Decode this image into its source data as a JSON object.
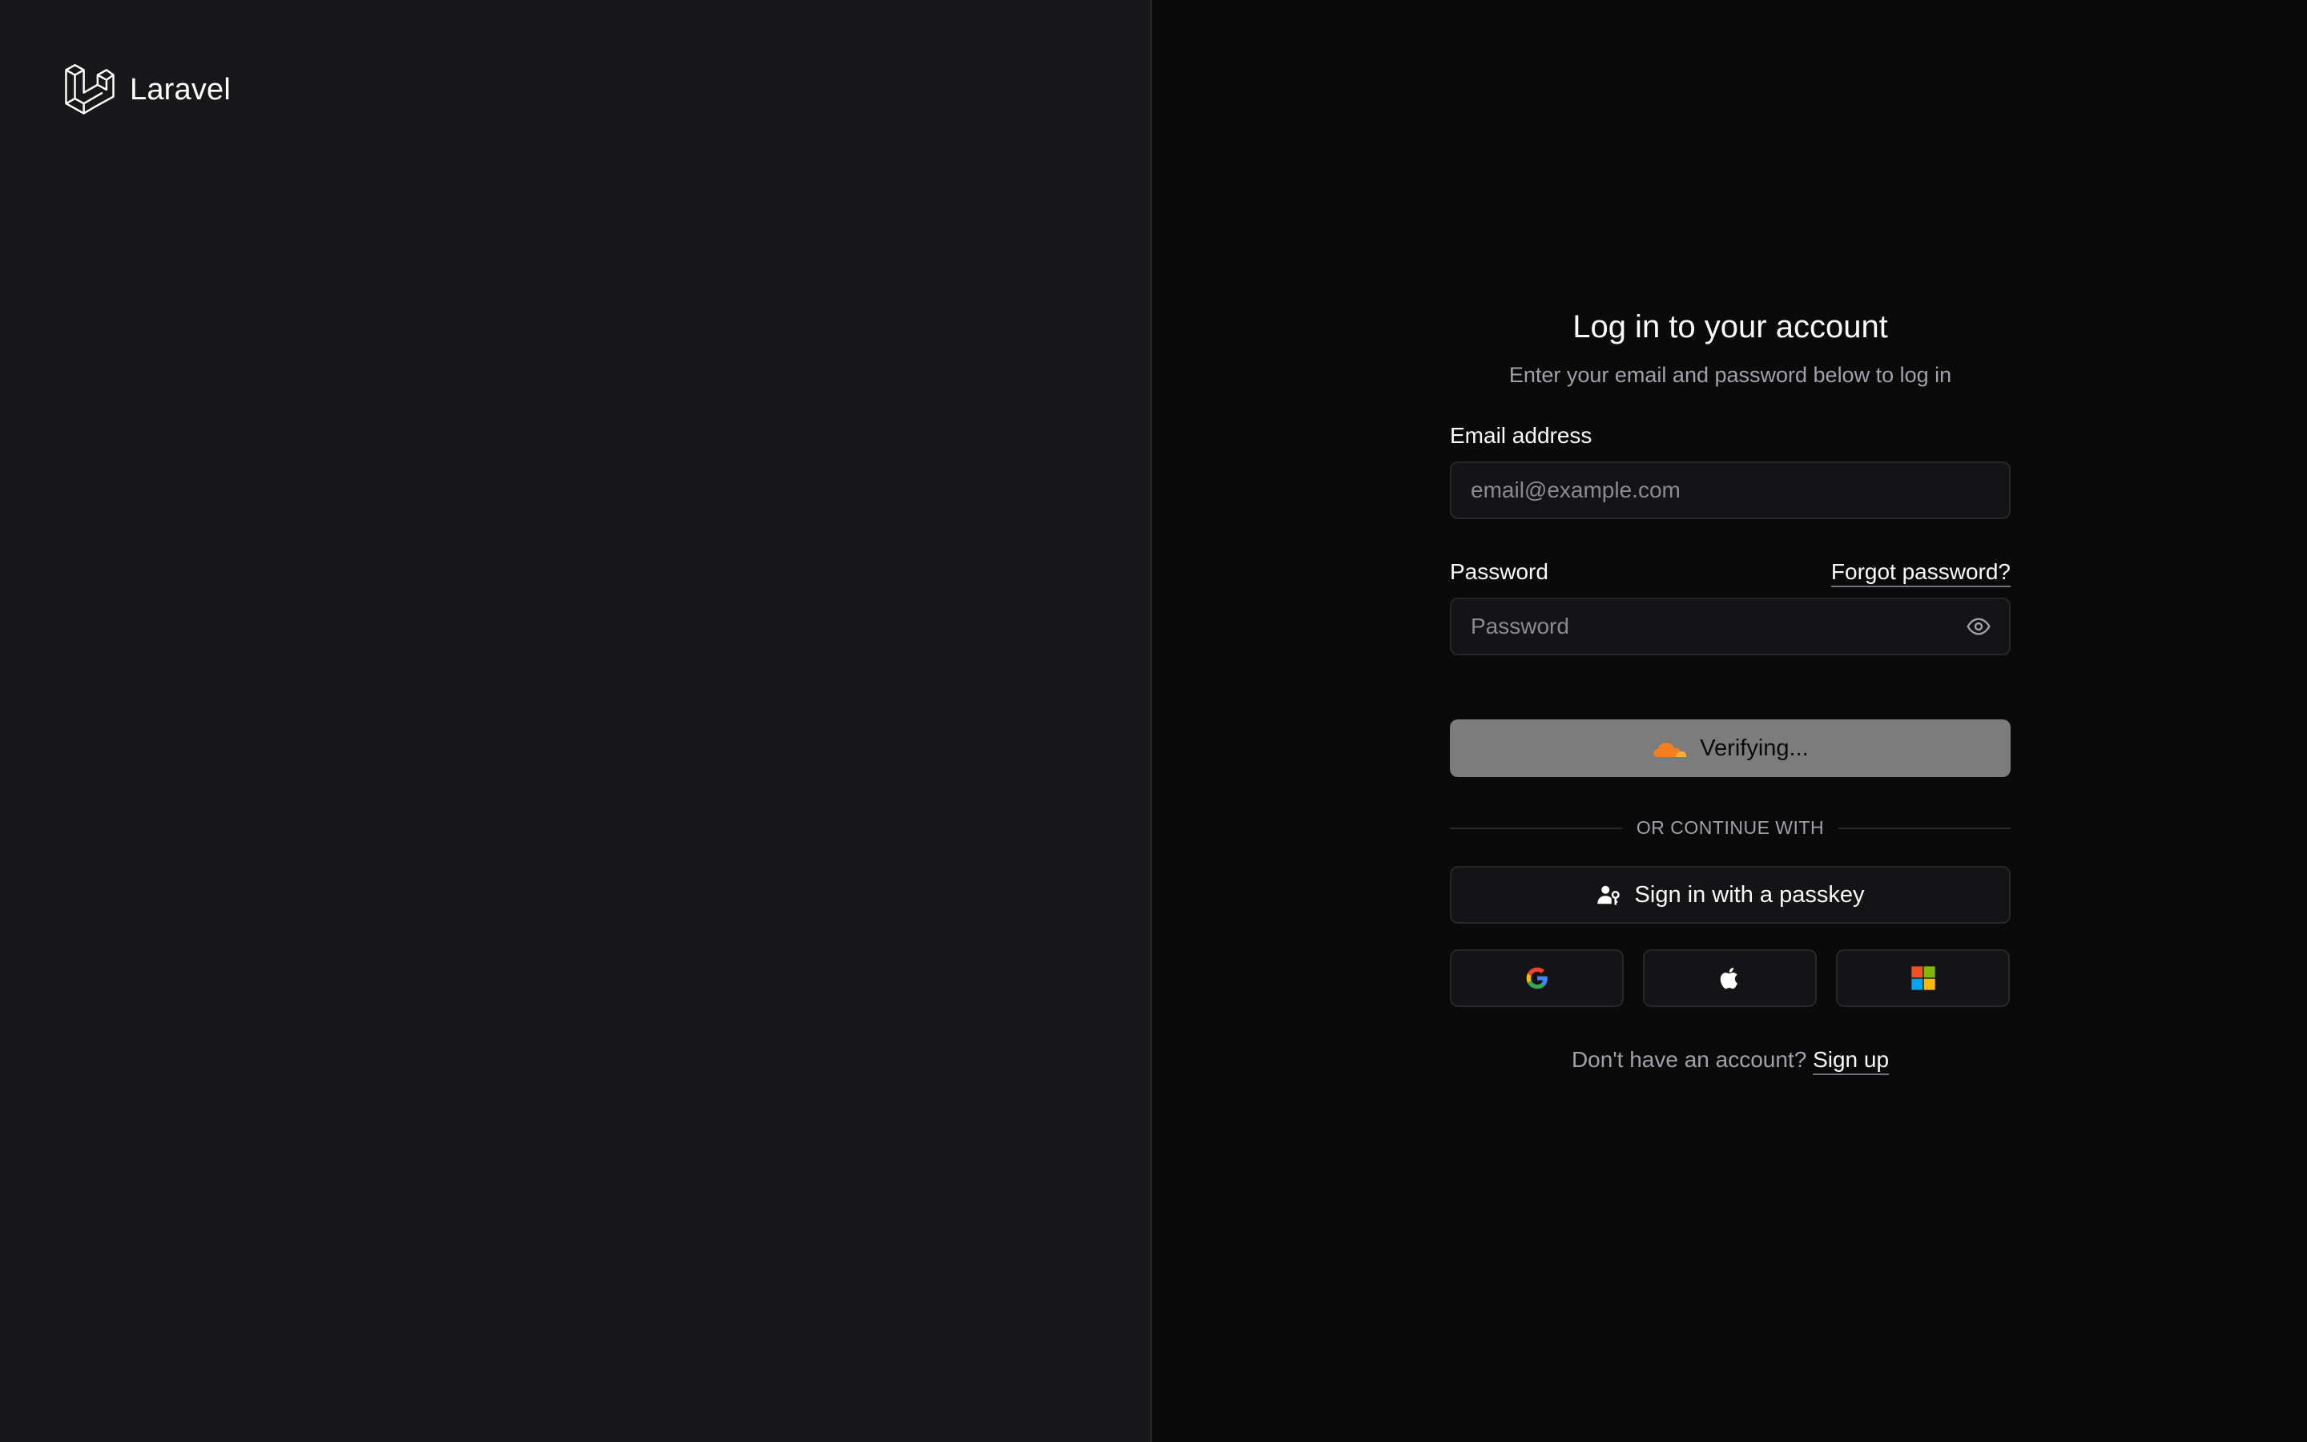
{
  "brand": {
    "name": "Laravel",
    "logo_icon": "laravel-logo-icon"
  },
  "login": {
    "title": "Log in to your account",
    "subtitle": "Enter your email and password below to log in",
    "email": {
      "label": "Email address",
      "placeholder": "email@example.com",
      "value": ""
    },
    "password": {
      "label": "Password",
      "placeholder": "Password",
      "value": "",
      "toggle_icon": "eye-icon"
    },
    "forgot_link": "Forgot password?",
    "submit_label": "Verifying...",
    "submit_icon": "cloudflare-icon",
    "divider_text": "OR CONTINUE WITH",
    "passkey_label": "Sign in with a passkey",
    "passkey_icon": "passkey-user-icon",
    "social": [
      "google-icon",
      "apple-icon",
      "microsoft-icon"
    ],
    "signup_prompt": "Don't have an account?",
    "signup_link": "Sign up"
  },
  "colors": {
    "left_panel_bg": "#18181b",
    "right_panel_bg": "#0a0a0a",
    "button_disabled": "#7c7c7c",
    "cloudflare_orange": "#f38020"
  }
}
